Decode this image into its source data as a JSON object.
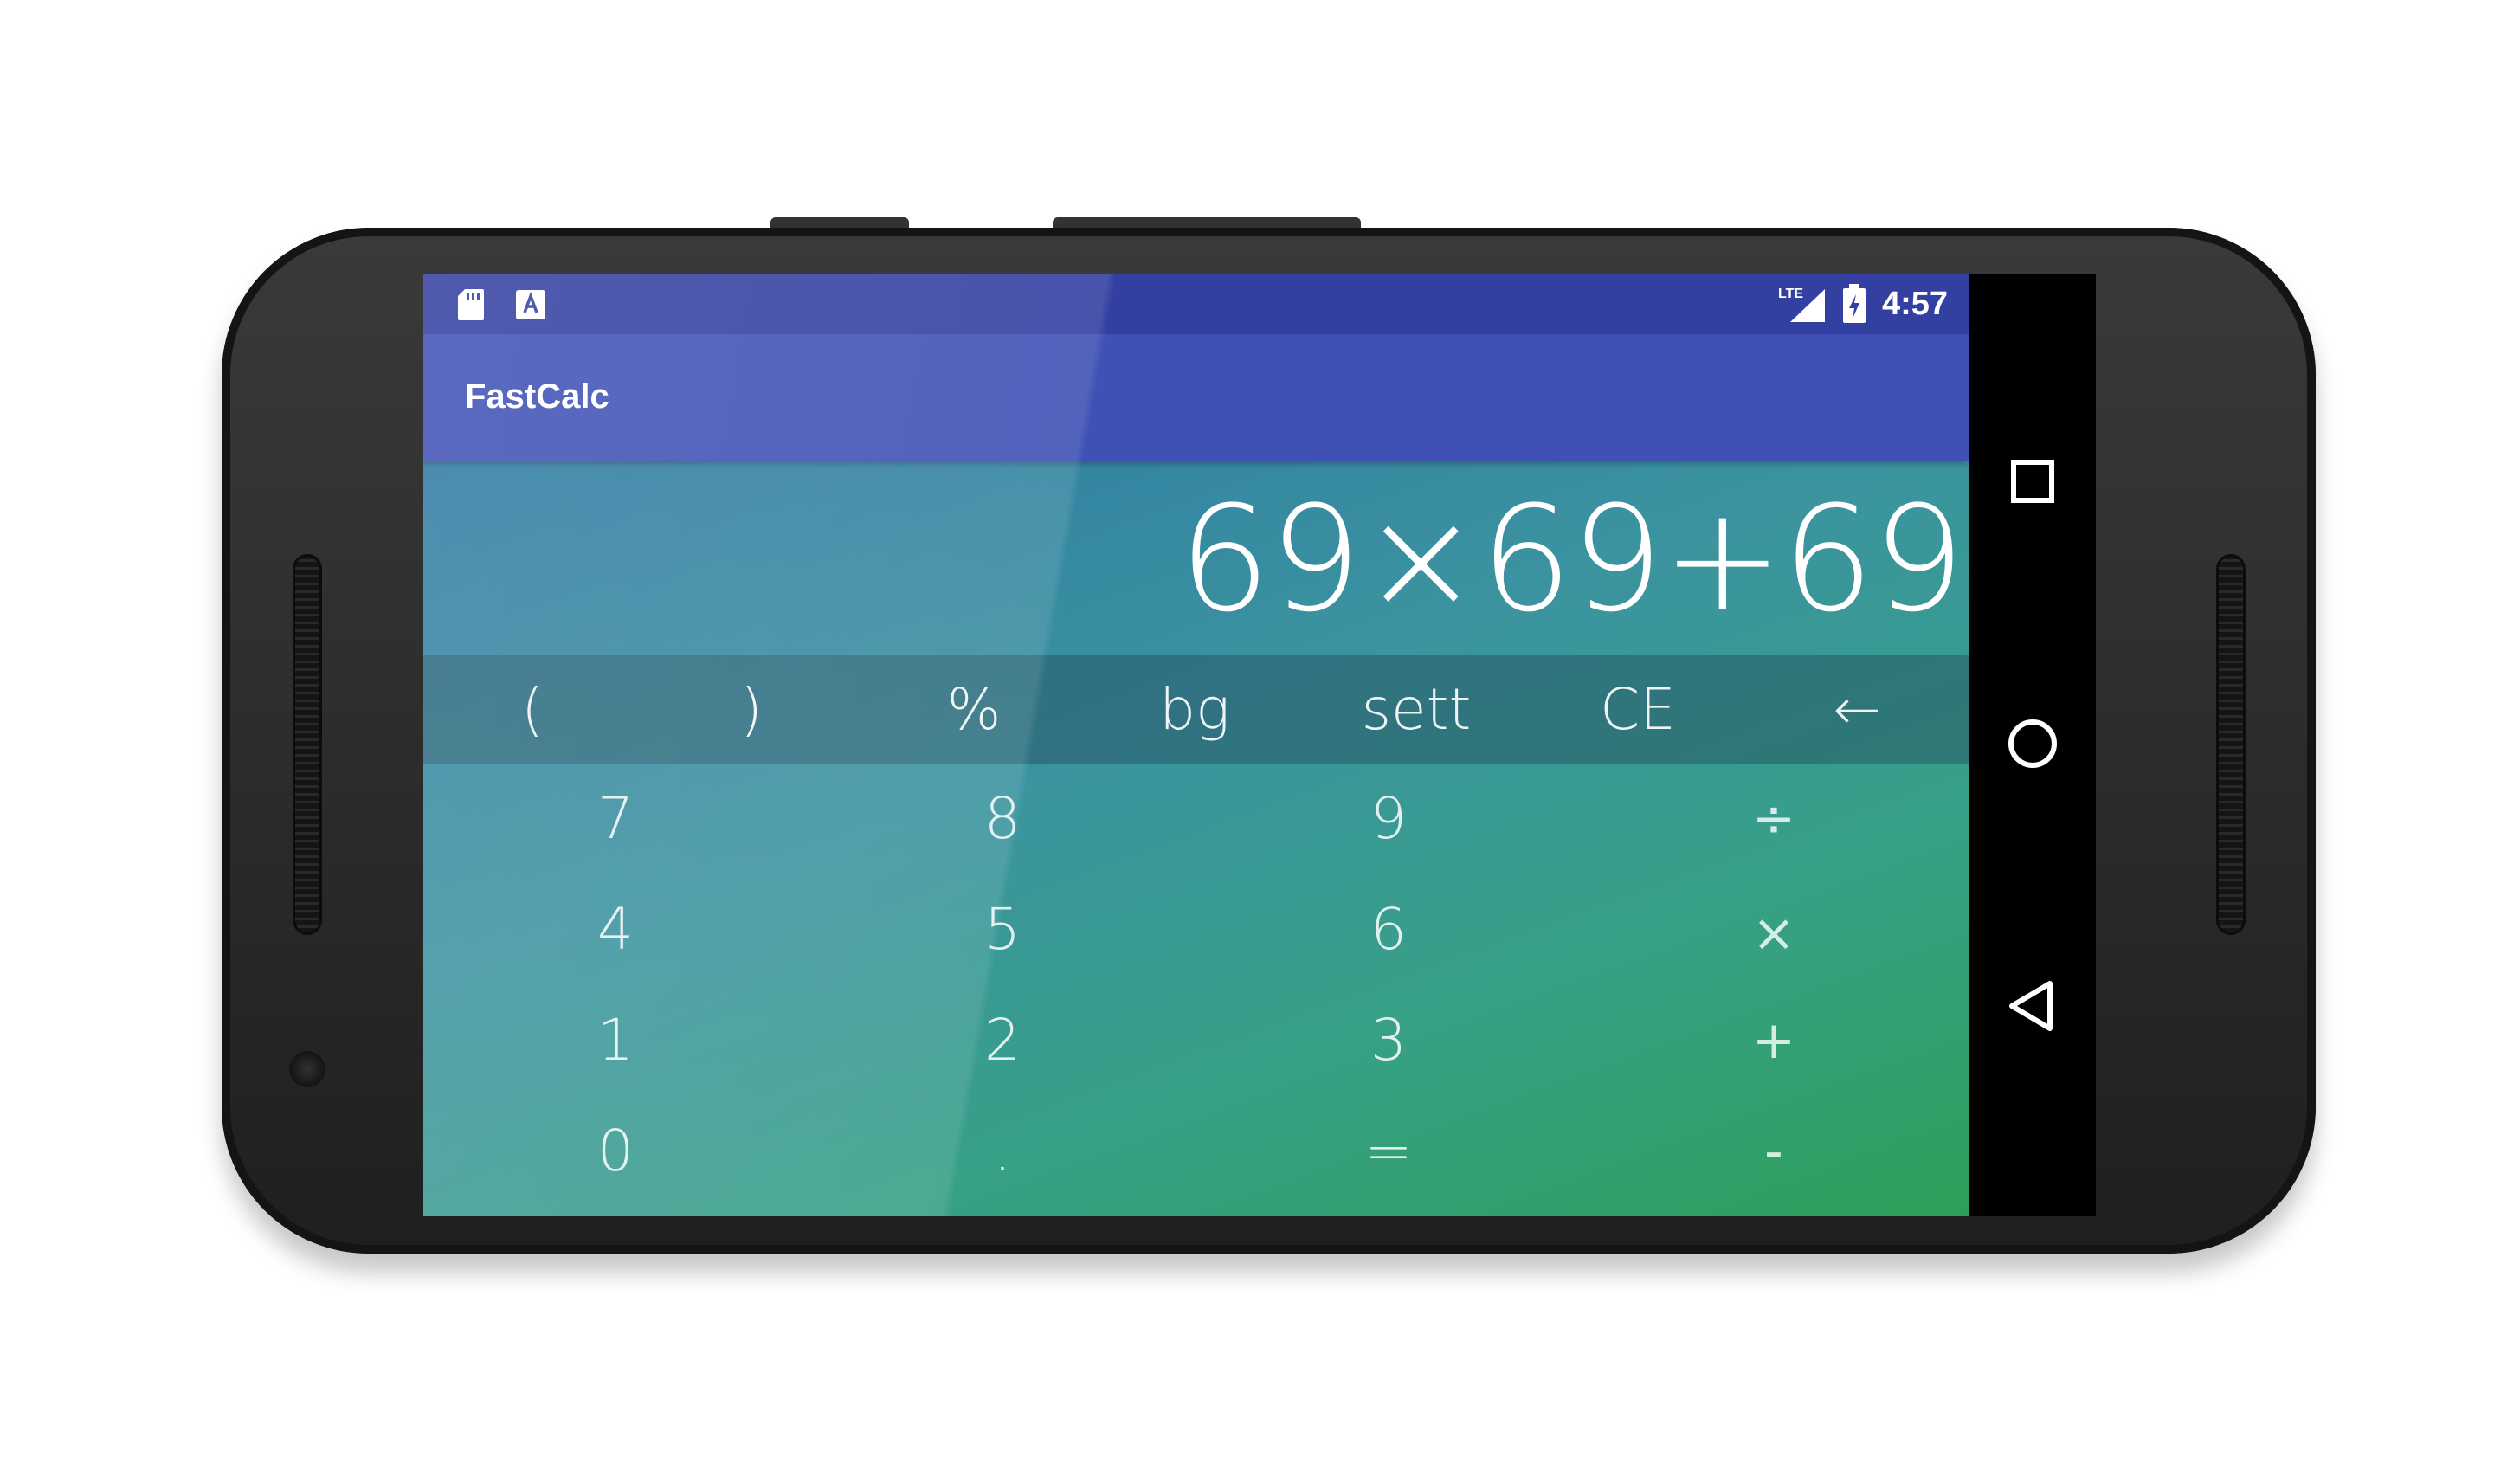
{
  "status_bar": {
    "time": "4:57",
    "network_label": "LTE",
    "left_icons": [
      "sd-card-icon",
      "keyboard-a-icon"
    ],
    "right_icons": [
      "lte-icon",
      "signal-icon",
      "battery-charging-icon"
    ]
  },
  "app_bar": {
    "title": "FastCalc"
  },
  "calculator": {
    "expression": "69×69+69",
    "function_keys": [
      "(",
      ")",
      "%",
      "bg",
      "sett",
      "CE",
      "←"
    ],
    "number_rows": [
      [
        "7",
        "8",
        "9",
        "÷"
      ],
      [
        "4",
        "5",
        "6",
        "×"
      ],
      [
        "1",
        "2",
        "3",
        "+"
      ],
      [
        "0",
        ".",
        "=",
        "-"
      ]
    ]
  },
  "nav_bar": {
    "buttons": [
      "recents-square-icon",
      "home-circle-icon",
      "back-triangle-icon"
    ]
  },
  "colors": {
    "status_bar": "#3340a1",
    "app_bar": "#3f51b5",
    "gradient_start": "#2e7aa2",
    "gradient_end": "#2e9f5a"
  }
}
